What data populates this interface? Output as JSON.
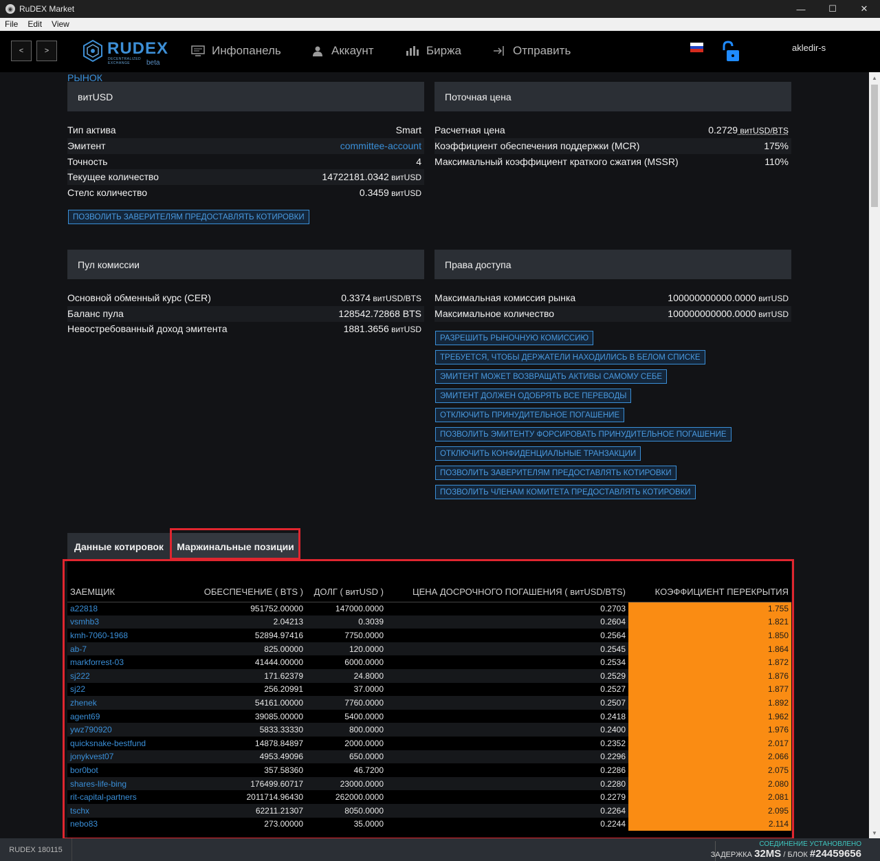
{
  "window": {
    "title": "RuDEX Market"
  },
  "menu": [
    "File",
    "Edit",
    "View"
  ],
  "header": {
    "back_label": "<",
    "forward_label": ">",
    "logo_text": "RUDEX",
    "logo_tagline": "DECENTRALIZED EXCHANGE",
    "logo_beta": "beta",
    "nav": [
      {
        "label": "Инфопанель",
        "icon": "dashboard-icon"
      },
      {
        "label": "Аккаунт",
        "icon": "user-icon"
      },
      {
        "label": "Биржа",
        "icon": "chart-icon"
      },
      {
        "label": "Отправить",
        "icon": "send-icon"
      }
    ],
    "username": "akledir-s"
  },
  "breadcrumb": "РЫНОК",
  "asset_panel": {
    "title": "витUSD",
    "rows": [
      {
        "label": "Тип актива",
        "value": "Smart",
        "unit": ""
      },
      {
        "label": "Эмитент",
        "value": "committee-account",
        "unit": ""
      },
      {
        "label": "Точность",
        "value": "4",
        "unit": ""
      },
      {
        "label": "Текущее количество",
        "value": "14722181.0342",
        "unit": " витUSD"
      },
      {
        "label": "Стелс количество",
        "value": "0.3459",
        "unit": " витUSD"
      }
    ],
    "button": "ПОЗВОЛИТЬ ЗАВЕРИТЕЛЯМ ПРЕДОСТАВЛЯТЬ КОТИРОВКИ"
  },
  "price_panel": {
    "title": "Поточная цена",
    "rows": [
      {
        "label": "Расчетная цена",
        "value": "0.2729",
        "unit": " витUSD/BTS"
      },
      {
        "label": "Коэффициент обеспечения поддержки (MCR)",
        "value": "175%",
        "unit": ""
      },
      {
        "label": "Максимальный коэффициент краткого сжатия (MSSR)",
        "value": "110%",
        "unit": ""
      }
    ]
  },
  "fee_pool_panel": {
    "title": "Пул комиссии",
    "rows": [
      {
        "label": "Основной обменный курс (CER)",
        "value": "0.3374",
        "unit": " витUSD/BTS"
      },
      {
        "label": "Баланс пула",
        "value": "128542.72868 BTS",
        "unit": ""
      },
      {
        "label": "Невостребованный доход эмитента",
        "value": "1881.3656",
        "unit": " витUSD"
      }
    ]
  },
  "permissions_panel": {
    "title": "Права доступа",
    "rows": [
      {
        "label": "Максимальная комиссия рынка",
        "value": "100000000000.0000",
        "unit": " витUSD"
      },
      {
        "label": "Максимальное количество",
        "value": "100000000000.0000",
        "unit": " витUSD"
      }
    ],
    "flags": [
      "РАЗРЕШИТЬ РЫНОЧНУЮ КОМИССИЮ",
      "ТРЕБУЕТСЯ, ЧТОБЫ ДЕРЖАТЕЛИ НАХОДИЛИСЬ В БЕЛОМ СПИСКЕ",
      "ЭМИТЕНТ МОЖЕТ ВОЗВРАЩАТЬ АКТИВЫ САМОМУ СЕБЕ",
      "ЭМИТЕНТ ДОЛЖЕН ОДОБРЯТЬ ВСЕ ПЕРЕВОДЫ",
      "ОТКЛЮЧИТЬ ПРИНУДИТЕЛЬНОЕ ПОГАШЕНИЕ",
      "ПОЗВОЛИТЬ ЭМИТЕНТУ ФОРСИРОВАТЬ ПРИНУДИТЕЛЬНОЕ ПОГАШЕНИЕ",
      "ОТКЛЮЧИТЬ КОНФИДЕНЦИАЛЬНЫЕ ТРАНЗАКЦИИ",
      "ПОЗВОЛИТЬ ЗАВЕРИТЕЛЯМ ПРЕДОСТАВЛЯТЬ КОТИРОВКИ",
      "ПОЗВОЛИТЬ ЧЛЕНАМ КОМИТЕТА ПРЕДОСТАВЛЯТЬ КОТИРОВКИ"
    ]
  },
  "tabs": [
    {
      "label": "Данные котировок",
      "active": false
    },
    {
      "label": "Маржинальные позиции",
      "active": true
    }
  ],
  "margin_table": {
    "headers": [
      "ЗАЕМЩИК",
      "ОБЕСПЕЧЕНИЕ ( BTS )",
      "ДОЛГ ( витUSD )",
      "ЦЕНА ДОСРОЧНОГО ПОГАШЕНИЯ ( витUSD/BTS)",
      "КОЭФФИЦИЕНТ ПЕРЕКРЫТИЯ"
    ],
    "rows": [
      [
        "a22818",
        "951752.00000",
        "147000.0000",
        "0.2703",
        "1.755"
      ],
      [
        "vsmhb3",
        "2.04213",
        "0.3039",
        "0.2604",
        "1.821"
      ],
      [
        "kmh-7060-1968",
        "52894.97416",
        "7750.0000",
        "0.2564",
        "1.850"
      ],
      [
        "ab-7",
        "825.00000",
        "120.0000",
        "0.2545",
        "1.864"
      ],
      [
        "markforrest-03",
        "41444.00000",
        "6000.0000",
        "0.2534",
        "1.872"
      ],
      [
        "sj222",
        "171.62379",
        "24.8000",
        "0.2529",
        "1.876"
      ],
      [
        "sj22",
        "256.20991",
        "37.0000",
        "0.2527",
        "1.877"
      ],
      [
        "zhenek",
        "54161.00000",
        "7760.0000",
        "0.2507",
        "1.892"
      ],
      [
        "agent69",
        "39085.00000",
        "5400.0000",
        "0.2418",
        "1.962"
      ],
      [
        "ywz790920",
        "5833.33330",
        "800.0000",
        "0.2400",
        "1.976"
      ],
      [
        "quicksnake-bestfund",
        "14878.84897",
        "2000.0000",
        "0.2352",
        "2.017"
      ],
      [
        "jonykvest07",
        "4953.49096",
        "650.0000",
        "0.2296",
        "2.066"
      ],
      [
        "bor0bot",
        "357.58360",
        "46.7200",
        "0.2286",
        "2.075"
      ],
      [
        "shares-life-bing",
        "176499.60717",
        "23000.0000",
        "0.2280",
        "2.080"
      ],
      [
        "rit-capital-partners",
        "2011714.96430",
        "262000.0000",
        "0.2279",
        "2.081"
      ],
      [
        "tschx",
        "62211.21307",
        "8050.0000",
        "0.2264",
        "2.095"
      ],
      [
        "nebo83",
        "273.00000",
        "35.0000",
        "0.2244",
        "2.114"
      ]
    ]
  },
  "status": {
    "version": "RUDEX 180115",
    "connection": "СОЕДИНЕНИЕ УСТАНОВЛЕНО",
    "latency_label": "ЗАДЕРЖКА",
    "latency_value": "32MS",
    "block_label": "/ БЛОК",
    "block_value": "#24459656"
  },
  "colors": {
    "accent": "#3a8fd8",
    "highlight_orange": "#fa8c13",
    "annotation_red": "#e0262f",
    "connected_green": "#3ec7c0"
  }
}
